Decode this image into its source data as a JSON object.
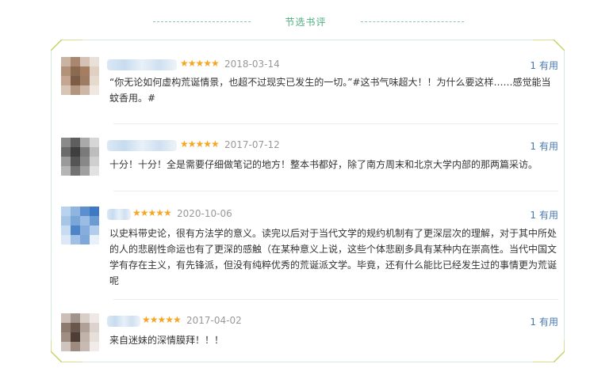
{
  "section_title": "节选书评",
  "useful_label": "有用",
  "star_glyphs": "★★★★★",
  "reviews": [
    {
      "date": "2018-03-14",
      "useful_count": "1",
      "rating": 5,
      "text": "“你无论如何虚构荒诞情景，也超不过现实已发生的一切。”#这书气味超大！！为什么要这样……感觉能当蚊香用。#",
      "avatar_colors": [
        "#c9b3a3",
        "#a88670",
        "#d4c2b4",
        "#e9e0d8",
        "#b29279",
        "#8b6a52",
        "#a57d61",
        "#dfd0c3",
        "#c4a691",
        "#7c5c46",
        "#9e7b63",
        "#e6d9cd",
        "#d7c5b6",
        "#b19580",
        "#cdb7a6",
        "#f0e8e0"
      ]
    },
    {
      "date": "2017-07-12",
      "useful_count": "1",
      "rating": 5,
      "text": "十分！十分！全是需要仔细做笔记的地方！整本书都好，除了南方周末和北京大学内部的那两篇采访。",
      "avatar_colors": [
        "#8a8a8a",
        "#5e5e5e",
        "#a9a9a9",
        "#d6d6d6",
        "#6b6b6b",
        "#3f3f3f",
        "#7a7a7a",
        "#bdbdbd",
        "#9a9a9a",
        "#555555",
        "#888888",
        "#cfcfcf",
        "#b5b5b5",
        "#727272",
        "#a0a0a0",
        "#e2e2e2"
      ]
    },
    {
      "date": "2020-10-06",
      "useful_count": "1",
      "rating": 5,
      "text": "以史料带史论，很有方法学的意义。读完以后对于当代文学的规约机制有了更深层次的理解，对于其中所处的人的悲剧性命运也有了更深的感触（在某种意义上说，这些个体悲剧多具有某种内在崇高性。当代中国文学有存在主义，有先锋派，但没有纯粹优秀的荒诞派文学。毕竟，还有什么能比已经发生过的事情更为荒诞呢",
      "avatar_colors": [
        "#b9d3ee",
        "#8fb4de",
        "#5d8fcf",
        "#3f78c4",
        "#a6c6e8",
        "#7aa6d8",
        "#9bbde3",
        "#6a9bd2",
        "#c8dcf1",
        "#4e85c9",
        "#86addb",
        "#b2cdec",
        "#dce8f6",
        "#a0c1e5",
        "#7ea8d9",
        "#e8f0f9"
      ]
    },
    {
      "date": "2017-04-02",
      "useful_count": "1",
      "rating": 5,
      "text": "来自迷妹的深情膜拜！！！",
      "avatar_colors": [
        "#cbbfb8",
        "#a3948b",
        "#d9cfc9",
        "#eee9e6",
        "#8e7b70",
        "#6a574c",
        "#b0a097",
        "#ddd3cd",
        "#a18e83",
        "#4f3e35",
        "#c2b3aa",
        "#e6dfda",
        "#d0c5be",
        "#9d8b80",
        "#c7bab2",
        "#f1ece9"
      ]
    }
  ]
}
